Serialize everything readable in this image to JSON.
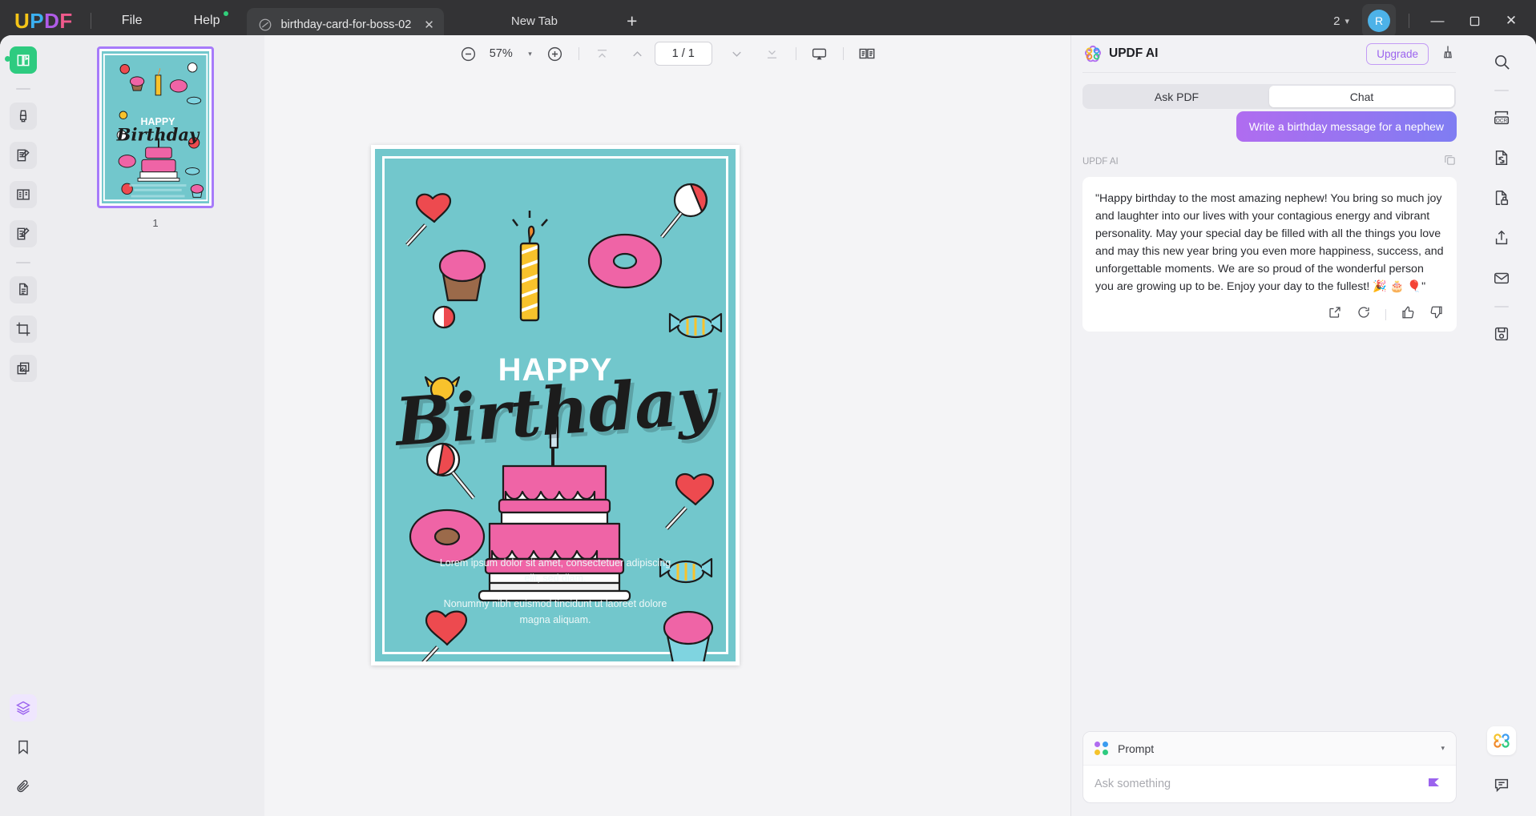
{
  "titlebar": {
    "logo": [
      "U",
      "P",
      "D",
      "F"
    ],
    "menus": [
      {
        "label": "File",
        "name": "menu-file",
        "dot": false
      },
      {
        "label": "Help",
        "name": "menu-help",
        "dot": true
      }
    ],
    "document_tab": {
      "name": "birthday-card-for-boss-02",
      "close_label": "✕",
      "icon": "pdf-file-icon"
    },
    "new_tab_label": "New Tab",
    "add_tab_label": "+",
    "account_count": "2",
    "account_chevron": "▾",
    "avatar_initial": "R",
    "window_controls": {
      "minimize": "—",
      "maximize": "☐",
      "close": "✕"
    }
  },
  "left_rail": {
    "items": [
      {
        "name": "sidebar-reader-icon",
        "state": "active"
      },
      {
        "name": "sidebar-highlighter-icon",
        "state": "normal"
      },
      {
        "name": "sidebar-edit-pdf-icon",
        "state": "normal"
      },
      {
        "name": "sidebar-page-layout-icon",
        "state": "normal"
      },
      {
        "name": "sidebar-annotate-icon",
        "state": "normal"
      },
      {
        "name": "sidebar-organize-pages-icon",
        "state": "normal"
      },
      {
        "name": "sidebar-crop-icon",
        "state": "normal"
      },
      {
        "name": "sidebar-batch-icon",
        "state": "normal"
      }
    ],
    "bottom_items": [
      {
        "name": "sidebar-layers-icon",
        "state": "selected"
      },
      {
        "name": "sidebar-bookmark-icon",
        "state": "normal"
      },
      {
        "name": "sidebar-attachment-icon",
        "state": "normal"
      }
    ]
  },
  "thumbnails": {
    "pages": [
      {
        "label": "1",
        "selected": true
      }
    ]
  },
  "doc_toolbar": {
    "zoom_out": "zoom-out-icon",
    "zoom_value": "57%",
    "zoom_chevron": "▾",
    "zoom_in": "zoom-in-icon",
    "first_page": "first-page-icon",
    "prev_page": "previous-page-icon",
    "page_indicator": "1 / 1",
    "next_page": "next-page-icon",
    "last_page": "last-page-icon",
    "presentation": "presentation-mode-icon",
    "page_view": "dual-page-view-icon"
  },
  "document": {
    "title_line1": "HAPPY",
    "title_line2": "Birthday",
    "body_paragraph_1": "Lorem ipsum dolor sit amet, consectetuer adipiscing elit, sed diam.",
    "body_paragraph_2": "Nonummy nibh euismod tincidunt ut laoreet dolore magna aliquam.",
    "background_color": "#72c7cc",
    "accent_pink": "#ef64a6",
    "accent_red": "#ed4a4f",
    "accent_yellow": "#f8c22c"
  },
  "ai_panel": {
    "title": "UPDF AI",
    "logo_icon": "updf-ai-flower-icon",
    "upgrade_label": "Upgrade",
    "broom_icon": "clear-chat-icon",
    "tabs": [
      {
        "label": "Ask PDF",
        "selected": false
      },
      {
        "label": "Chat",
        "selected": true
      }
    ],
    "messages": [
      {
        "role": "user",
        "text": "Write a birthday message for a nephew"
      },
      {
        "role": "assistant",
        "sender_label": "UPDF AI",
        "text": "\"Happy birthday to the most amazing nephew! You bring so much joy and laughter into our lives with your contagious energy and vibrant personality. May your special day be filled with all the things you love and may this new year bring you even more happiness, success, and unforgettable moments. We are so proud of the wonderful person you are growing up to be. Enjoy your day to the fullest! 🎉 🎂 🎈\""
      }
    ],
    "message_actions": [
      {
        "name": "insert-to-document-icon"
      },
      {
        "name": "regenerate-icon"
      },
      {
        "name": "thumbs-up-icon"
      },
      {
        "name": "thumbs-down-icon"
      }
    ],
    "copy_icon": "copy-icon",
    "prompt": {
      "label": "Prompt",
      "chevron": "▾",
      "input_value": "",
      "placeholder": "Ask something",
      "send_icon": "send-icon",
      "dot_colors": [
        "#b06cf0",
        "#3b9cf0",
        "#f5c32c",
        "#2ecb80"
      ]
    }
  },
  "right_rail": {
    "items": [
      {
        "name": "search-icon"
      },
      {
        "name": "ocr-icon"
      },
      {
        "name": "convert-pdf-icon"
      },
      {
        "name": "protect-pdf-icon"
      },
      {
        "name": "share-icon"
      },
      {
        "name": "email-icon"
      },
      {
        "name": "save-as-icon"
      }
    ],
    "bottom_items": [
      {
        "name": "updf-ai-icon"
      },
      {
        "name": "feedback-comment-icon"
      }
    ]
  }
}
